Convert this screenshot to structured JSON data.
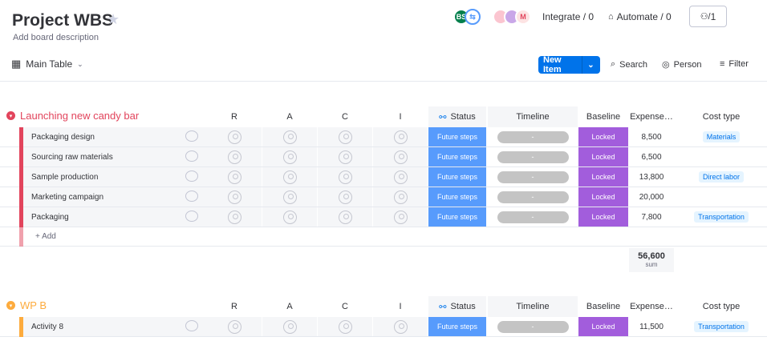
{
  "board": {
    "title": "Project WBS",
    "description": "Add board description"
  },
  "header": {
    "avatar_initials": "BS",
    "integrate_label": "Integrate / 0",
    "automate_label": "Automate / 0",
    "persons_count": "1"
  },
  "toolbar": {
    "view_label": "Main Table",
    "new_item_label": "New Item",
    "search_label": "Search",
    "person_label": "Person",
    "filter_label": "Filter"
  },
  "columns": {
    "r": "R",
    "a": "A",
    "c": "C",
    "i": "I",
    "status": "Status",
    "timeline": "Timeline",
    "baseline": "Baseline",
    "expenses": "Expense…",
    "cost_type": "Cost type"
  },
  "groups": [
    {
      "title": "Launching new candy bar",
      "color": "#e2445c",
      "items": [
        {
          "name": "Packaging design",
          "status": "Future steps",
          "timeline": "-",
          "baseline": "Locked",
          "expenses": "8,500",
          "cost_type": "Materials"
        },
        {
          "name": "Sourcing raw materials",
          "status": "Future steps",
          "timeline": "-",
          "baseline": "Locked",
          "expenses": "6,500",
          "cost_type": ""
        },
        {
          "name": "Sample production",
          "status": "Future steps",
          "timeline": "-",
          "baseline": "Locked",
          "expenses": "13,800",
          "cost_type": "Direct labor"
        },
        {
          "name": "Marketing campaign",
          "status": "Future steps",
          "timeline": "-",
          "baseline": "Locked",
          "expenses": "20,000",
          "cost_type": ""
        },
        {
          "name": "Packaging",
          "status": "Future steps",
          "timeline": "-",
          "baseline": "Locked",
          "expenses": "7,800",
          "cost_type": "Transportation"
        }
      ],
      "add_label": "+ Add",
      "sum_value": "56,600",
      "sum_label": "sum"
    },
    {
      "title": "WP B",
      "color": "#fdab3d",
      "items": [
        {
          "name": "Activity 8",
          "status": "Future steps",
          "timeline": "-",
          "baseline": "Locked",
          "expenses": "11,500",
          "cost_type": "Transportation"
        }
      ]
    }
  ],
  "colors": {
    "primary": "#0073ea",
    "status_blue": "#579bfc",
    "baseline_purple": "#a25ddc",
    "group1": "#e2445c",
    "group2": "#fdab3d"
  }
}
